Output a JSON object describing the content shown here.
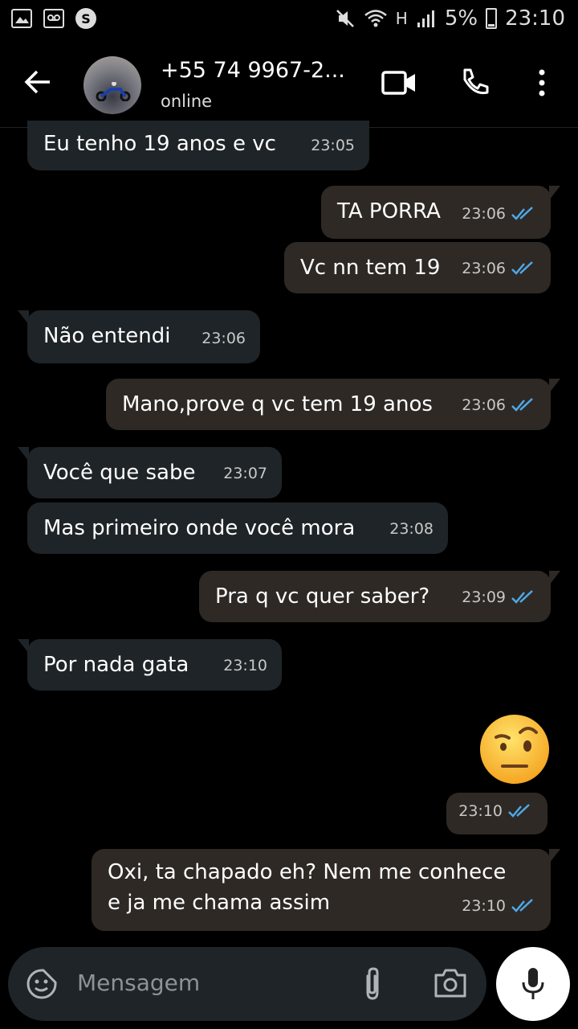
{
  "status_bar": {
    "battery": "5%",
    "time": "23:10",
    "network": "H"
  },
  "header": {
    "contact_name": "+55 74 9967-2...",
    "status": "online"
  },
  "messages": [
    {
      "text": "Eu tenho 19 anos e vc",
      "time": "23:05",
      "direction": "in"
    },
    {
      "text": "TA PORRA",
      "time": "23:06",
      "direction": "out"
    },
    {
      "text": "Vc nn tem 19",
      "time": "23:06",
      "direction": "out"
    },
    {
      "text": "Não entendi",
      "time": "23:06",
      "direction": "in"
    },
    {
      "text": "Mano,prove q vc tem 19 anos",
      "time": "23:06",
      "direction": "out"
    },
    {
      "text": "Você que sabe",
      "time": "23:07",
      "direction": "in"
    },
    {
      "text": "Mas primeiro onde você mora",
      "time": "23:08",
      "direction": "in"
    },
    {
      "text": "Pra q vc quer saber?",
      "time": "23:09",
      "direction": "out"
    },
    {
      "text": "Por nada gata",
      "time": "23:10",
      "direction": "in"
    },
    {
      "text": "",
      "time": "23:10",
      "direction": "out",
      "emoji": "face-with-raised-eyebrow"
    },
    {
      "text_line1": "Oxi, ta chapado eh? Nem me conhece",
      "text_line2": "e ja me chama assim",
      "time": "23:10",
      "direction": "out"
    }
  ],
  "input": {
    "placeholder": "Mensagem"
  },
  "colors": {
    "incoming": "#1e2428",
    "outgoing": "#2e2924",
    "read_ticks": "#4fa8e8"
  }
}
